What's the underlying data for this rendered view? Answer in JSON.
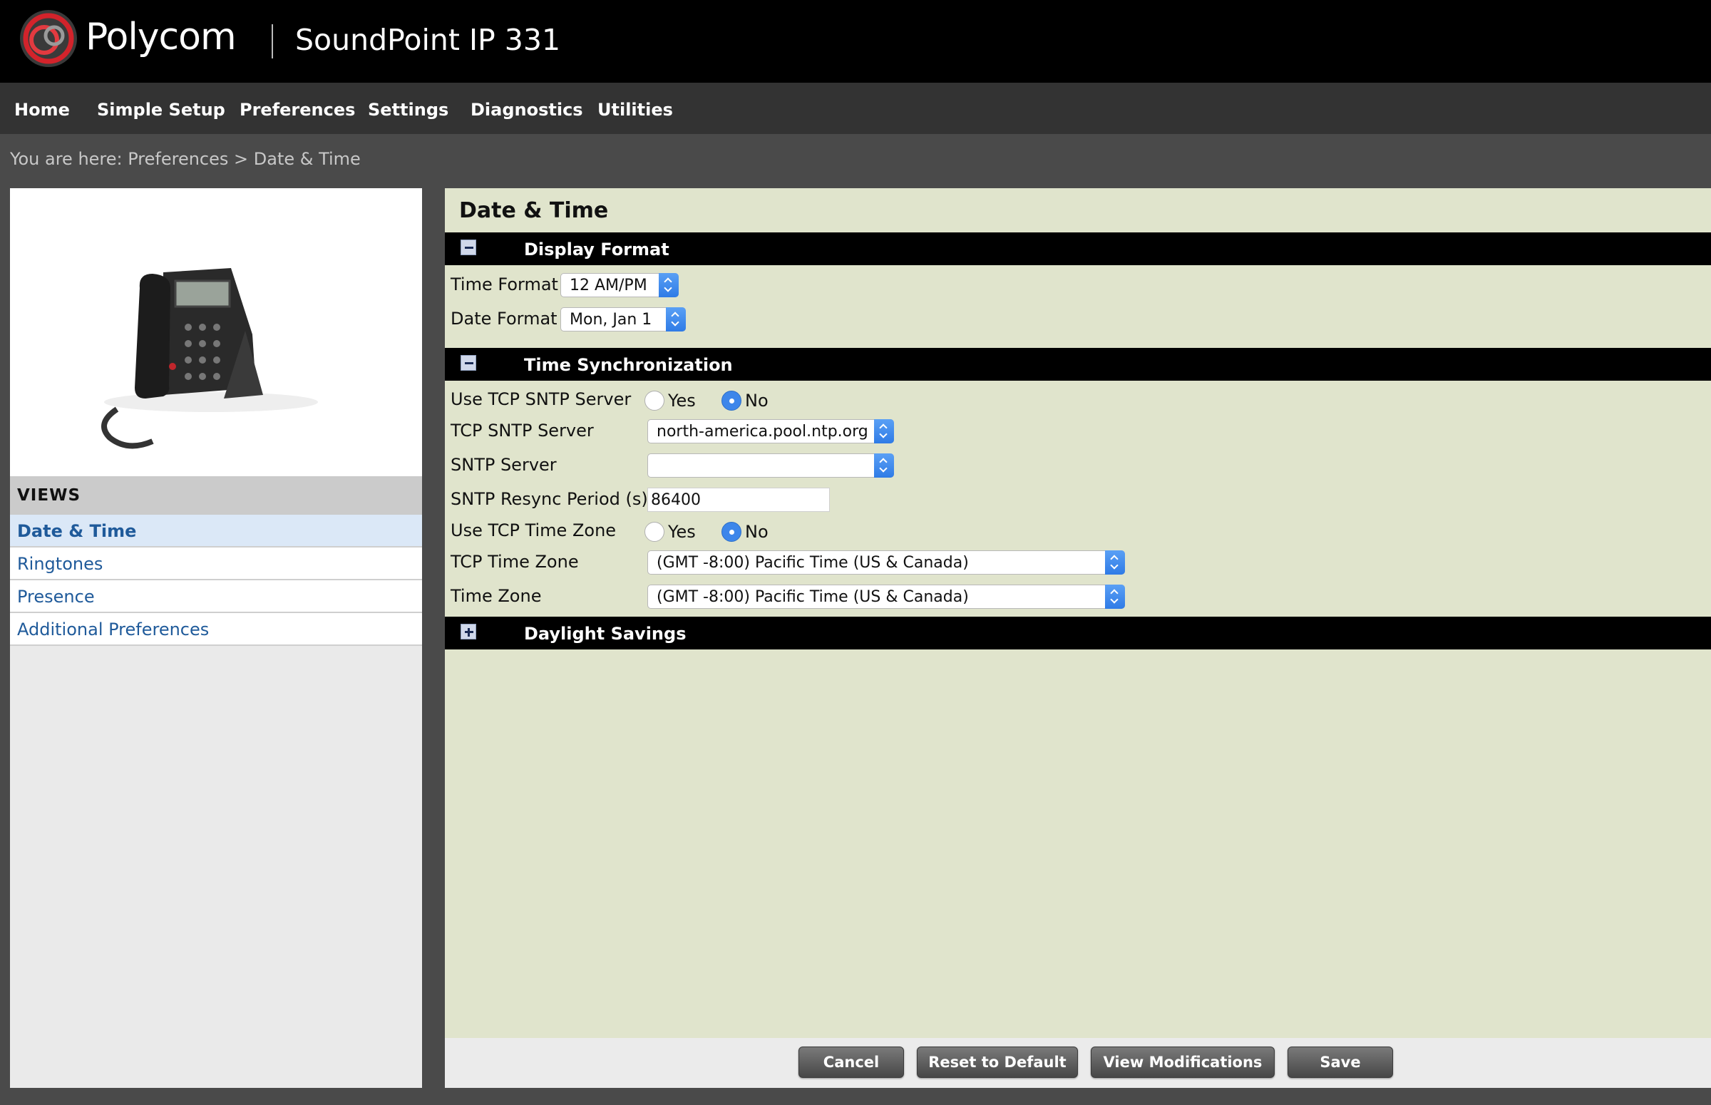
{
  "header": {
    "brand": "Polycom",
    "product": "SoundPoint IP 331"
  },
  "nav": {
    "items": [
      "Home",
      "Simple Setup",
      "Preferences",
      "Settings",
      "Diagnostics",
      "Utilities"
    ]
  },
  "breadcrumb": "You are here: Preferences > Date & Time",
  "sidebar": {
    "views_title": "VIEWS",
    "items": [
      {
        "label": "Date & Time",
        "active": true
      },
      {
        "label": "Ringtones",
        "active": false
      },
      {
        "label": "Presence",
        "active": false
      },
      {
        "label": "Additional Preferences",
        "active": false
      }
    ]
  },
  "main": {
    "title": "Date & Time",
    "display_format": {
      "title": "Display Format",
      "time_format_label": "Time Format",
      "time_format_value": "12 AM/PM",
      "date_format_label": "Date Format",
      "date_format_value": "Mon, Jan 1"
    },
    "time_sync": {
      "title": "Time Synchronization",
      "use_tcp_sntp_label": "Use TCP SNTP Server",
      "use_tcp_sntp_value": "No",
      "tcp_sntp_server_label": "TCP SNTP Server",
      "tcp_sntp_server_value": "north-america.pool.ntp.org",
      "sntp_server_label": "SNTP Server",
      "sntp_server_value": "",
      "resync_label": "SNTP Resync Period (s)",
      "resync_value": "86400",
      "use_tcp_tz_label": "Use TCP Time Zone",
      "use_tcp_tz_value": "No",
      "tcp_tz_label": "TCP Time Zone",
      "tcp_tz_value": "(GMT -8:00) Pacific Time (US & Canada)",
      "tz_label": "Time Zone",
      "tz_value": "(GMT -8:00) Pacific Time (US & Canada)",
      "yes_label": "Yes",
      "no_label": "No"
    },
    "daylight": {
      "title": "Daylight Savings"
    }
  },
  "buttons": {
    "cancel": "Cancel",
    "reset": "Reset to Default",
    "view_mods": "View Modifications",
    "save": "Save"
  },
  "colors": {
    "header_bg": "#000000",
    "nav_bg": "#333333",
    "main_bg": "#e0e4cc",
    "accent_blue": "#3d86ea",
    "link_blue": "#1f5a9a"
  }
}
